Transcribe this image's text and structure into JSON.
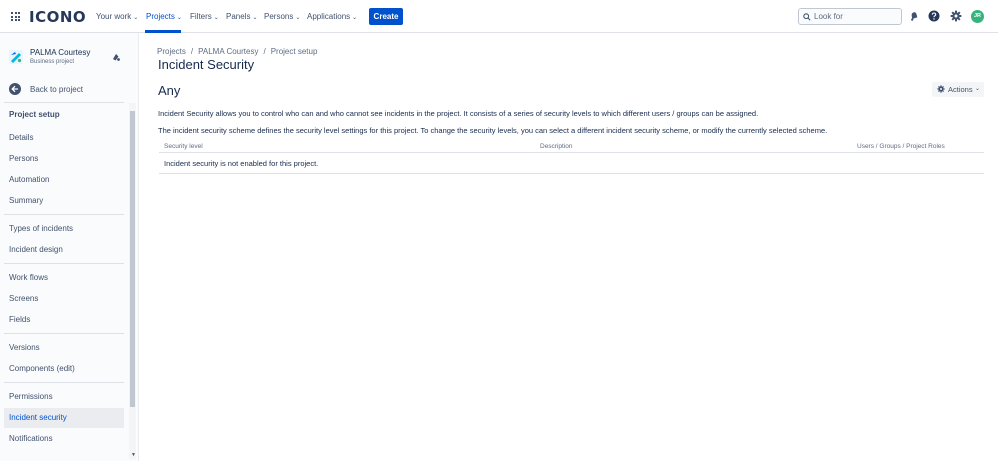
{
  "nav": {
    "logo": "ICONO",
    "items": [
      {
        "label": "Your work",
        "chevron": "⌄"
      },
      {
        "label": "Projects",
        "chevron": "⌄"
      },
      {
        "label": "Filters",
        "chevron": "⌄"
      },
      {
        "label": "Panels",
        "chevron": "⌄"
      },
      {
        "label": "Persons",
        "chevron": "⌄"
      },
      {
        "label": "Applications",
        "chevron": "⌄"
      }
    ],
    "create_label": "Create",
    "search_placeholder": "Look for",
    "avatar_initials": "JR",
    "accent_color": "#0052cc",
    "avatar_color": "#36b37e"
  },
  "sidebar": {
    "project_name": "PALMA Courtesy",
    "project_type": "Business project",
    "back_label": "Back to project",
    "heading": "Project setup",
    "items": [
      {
        "label": "Details"
      },
      {
        "label": "Persons"
      },
      {
        "label": "Automation"
      },
      {
        "label": "Summary"
      },
      {
        "label": "Types of incidents"
      },
      {
        "label": "Incident design"
      },
      {
        "label": "Work flows"
      },
      {
        "label": "Screens"
      },
      {
        "label": "Fields"
      },
      {
        "label": "Versions"
      },
      {
        "label": "Components (edit)"
      },
      {
        "label": "Permissions"
      },
      {
        "label": "Incident security",
        "selected": true
      },
      {
        "label": "Notifications"
      }
    ]
  },
  "breadcrumb": [
    "Projects",
    "PALMA Courtesy",
    "Project setup"
  ],
  "breadcrumb_sep": "/",
  "page_title": "Incident Security",
  "section_title": "Any",
  "actions_label": "Actions",
  "description": [
    "Incident Security allows you to control who can and who cannot see incidents in the project. It consists of a series of security levels to which different users / groups can be assigned.",
    "The incident security scheme defines the security level settings for this project. To change the security levels, you can select a different incident security scheme, or modify the currently selected scheme."
  ],
  "table": {
    "headers": [
      "Security level",
      "Description",
      "Users / Groups / Project Roles"
    ],
    "empty_message": "Incident security is not enabled for this project."
  }
}
